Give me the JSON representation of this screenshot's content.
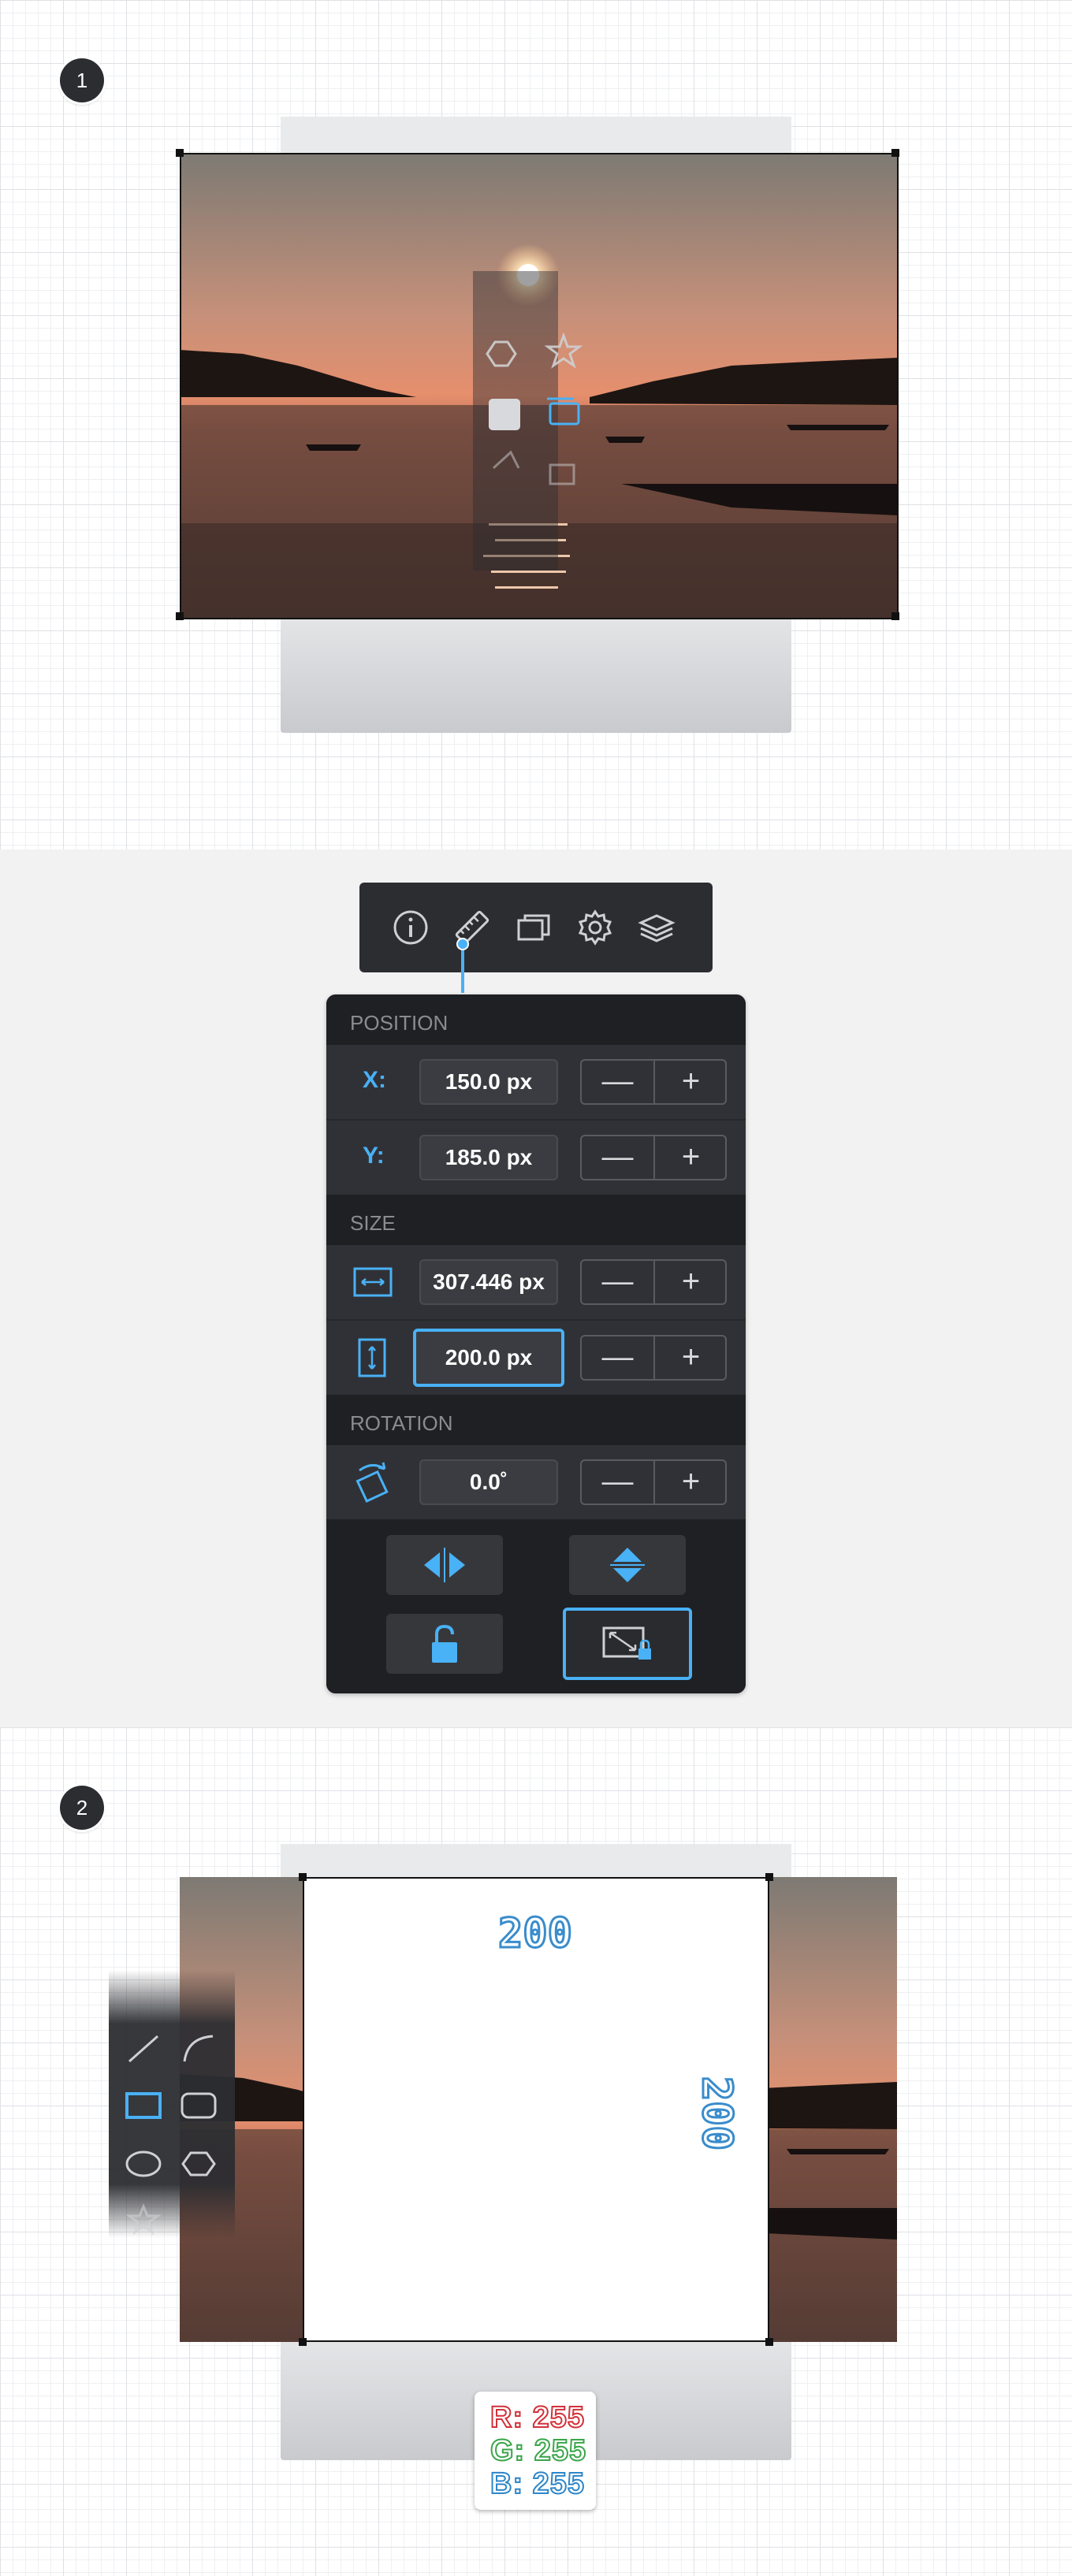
{
  "step1": {
    "badge": "1"
  },
  "step2": {
    "badge": "2"
  },
  "toolbar": {
    "tabs": [
      {
        "icon": "info-icon"
      },
      {
        "icon": "ruler-icon",
        "active": true
      },
      {
        "icon": "windows-icon"
      },
      {
        "icon": "gear-icon"
      },
      {
        "icon": "layers-icon"
      }
    ]
  },
  "panel": {
    "position_title": "POSITION",
    "x_label": "X:",
    "x_value": "150.0 px",
    "y_label": "Y:",
    "y_value": "185.0 px",
    "size_title": "SIZE",
    "width_value": "307.446 px",
    "height_value": "200.0 px",
    "rotation_title": "ROTATION",
    "rotation_value": "0.0˚",
    "minus": "—",
    "plus": "+"
  },
  "canvas2": {
    "width_label": "200",
    "height_label": "200"
  },
  "color_readout": {
    "r": "R: 255",
    "g": "G: 255",
    "b": "B: 255"
  },
  "colors": {
    "accent": "#49b1f5",
    "panel_bg": "#27282b",
    "red": "#d2313a",
    "green": "#3aa54a",
    "blue": "#2e86c9"
  }
}
